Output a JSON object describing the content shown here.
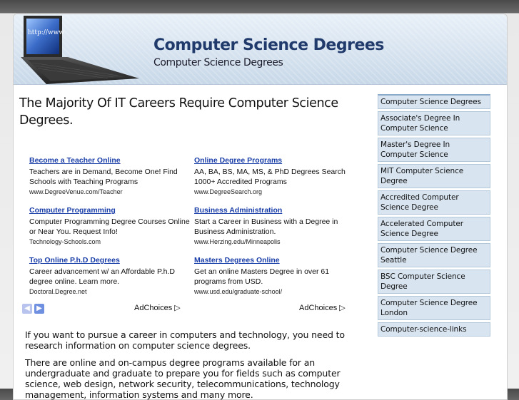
{
  "header": {
    "title": "Computer Science Degrees",
    "subtitle": "Computer Science Degrees",
    "laptop_screen_text": "http://www"
  },
  "main": {
    "heading": "The Majority Of IT Careers Require Computer Science Degrees.",
    "ads": [
      {
        "title": "Become a Teacher Online",
        "text": "Teachers are in Demand, Become One! Find Schools with Teaching Programs",
        "url": "www.DegreeVenue.com/Teacher"
      },
      {
        "title": "Online Degree Programs",
        "text": "AA, BA, BS, MA, MS, & PhD Degrees Search 1000+ Accredited Programs",
        "url": "www.DegreeSearch.org"
      },
      {
        "title": "Computer Programming",
        "text": "Computer Programming Degree Courses Online or Near You. Request Info!",
        "url": "Technology-Schools.com"
      },
      {
        "title": "Business Administration",
        "text": "Start a Career in Business with a Degree in Business Administration.",
        "url": "www.Herzing.edu/Minneapolis"
      },
      {
        "title": "Top Online P.h.D Degrees",
        "text": "Career advancement w/ an Affordable P.h.D degree online. Learn more.",
        "url": "Doctoral.Degree.net"
      },
      {
        "title": "Masters Degrees Online",
        "text": "Get an online Masters Degree in over 61 programs from USD.",
        "url": "www.usd.edu/graduate-school/"
      }
    ],
    "adchoices_label": "AdChoices",
    "paragraph1": " If you want to pursue a career in computers and technology, you need to research information on computer science degrees.",
    "paragraph2": "There are online and on-campus degree programs available for an undergraduate and graduate to prepare you for fields such as computer science, web design, network security, telecommunications, technology management, information systems and many more."
  },
  "sidebar": {
    "items": [
      "Computer Science Degrees",
      "Associate's Degree In Computer Science",
      "Master's Degree In Computer Science",
      "MIT Computer Science Degree",
      "Accredited Computer Science Degree",
      "Accelerated Computer Science Degree",
      "Computer Science Degree Seattle",
      "BSC Computer Science Degree",
      "Computer Science Degree London",
      "Computer-science-links"
    ]
  },
  "colors": {
    "title": "#1f3a6b",
    "ad_link": "#1a3ea8",
    "sidebar_bg": "#d8e4f0",
    "nav_button": "#6f8fe0"
  }
}
